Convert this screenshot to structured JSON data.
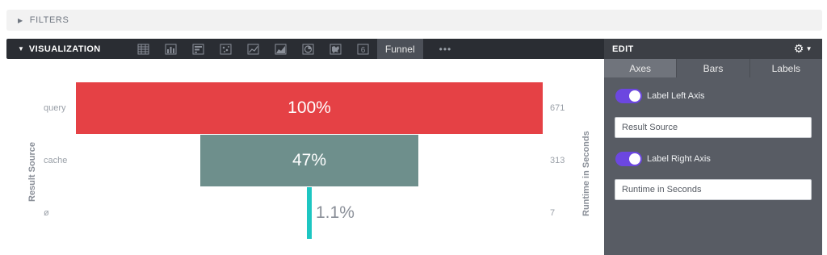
{
  "filters": {
    "label": "FILTERS"
  },
  "visualization": {
    "title": "VISUALIZATION",
    "icons": [
      "table-icon",
      "bar-chart-icon",
      "single-value-icon",
      "scatter-icon",
      "line-chart-icon",
      "area-chart-icon",
      "pie-chart-icon",
      "map-icon",
      "single-number-icon"
    ],
    "single_number_glyph": "6",
    "active_tab": "Funnel",
    "more": "•••"
  },
  "chart": {
    "left_axis_label": "Result Source",
    "right_axis_label": "Runtime in Seconds",
    "colors": {
      "query": "#e54145",
      "cache": "#6e8f8c",
      "none": "#1dc6c2"
    }
  },
  "chart_data": {
    "type": "bar",
    "categories": [
      "query",
      "cache",
      "ø"
    ],
    "values": [
      671,
      313,
      7
    ],
    "percent_labels": [
      "100%",
      "47%",
      "1.1%"
    ],
    "xlabel": "Result Source",
    "ylabel": "Runtime in Seconds"
  },
  "edit": {
    "title": "EDIT",
    "tabs": [
      "Axes",
      "Bars",
      "Labels"
    ],
    "active_tab": "Axes",
    "label_left_axis": "Label Left Axis",
    "left_axis_value": "Result Source",
    "label_right_axis": "Label Right Axis",
    "right_axis_value": "Runtime in Seconds",
    "toggle_color": "#6c47e0"
  }
}
